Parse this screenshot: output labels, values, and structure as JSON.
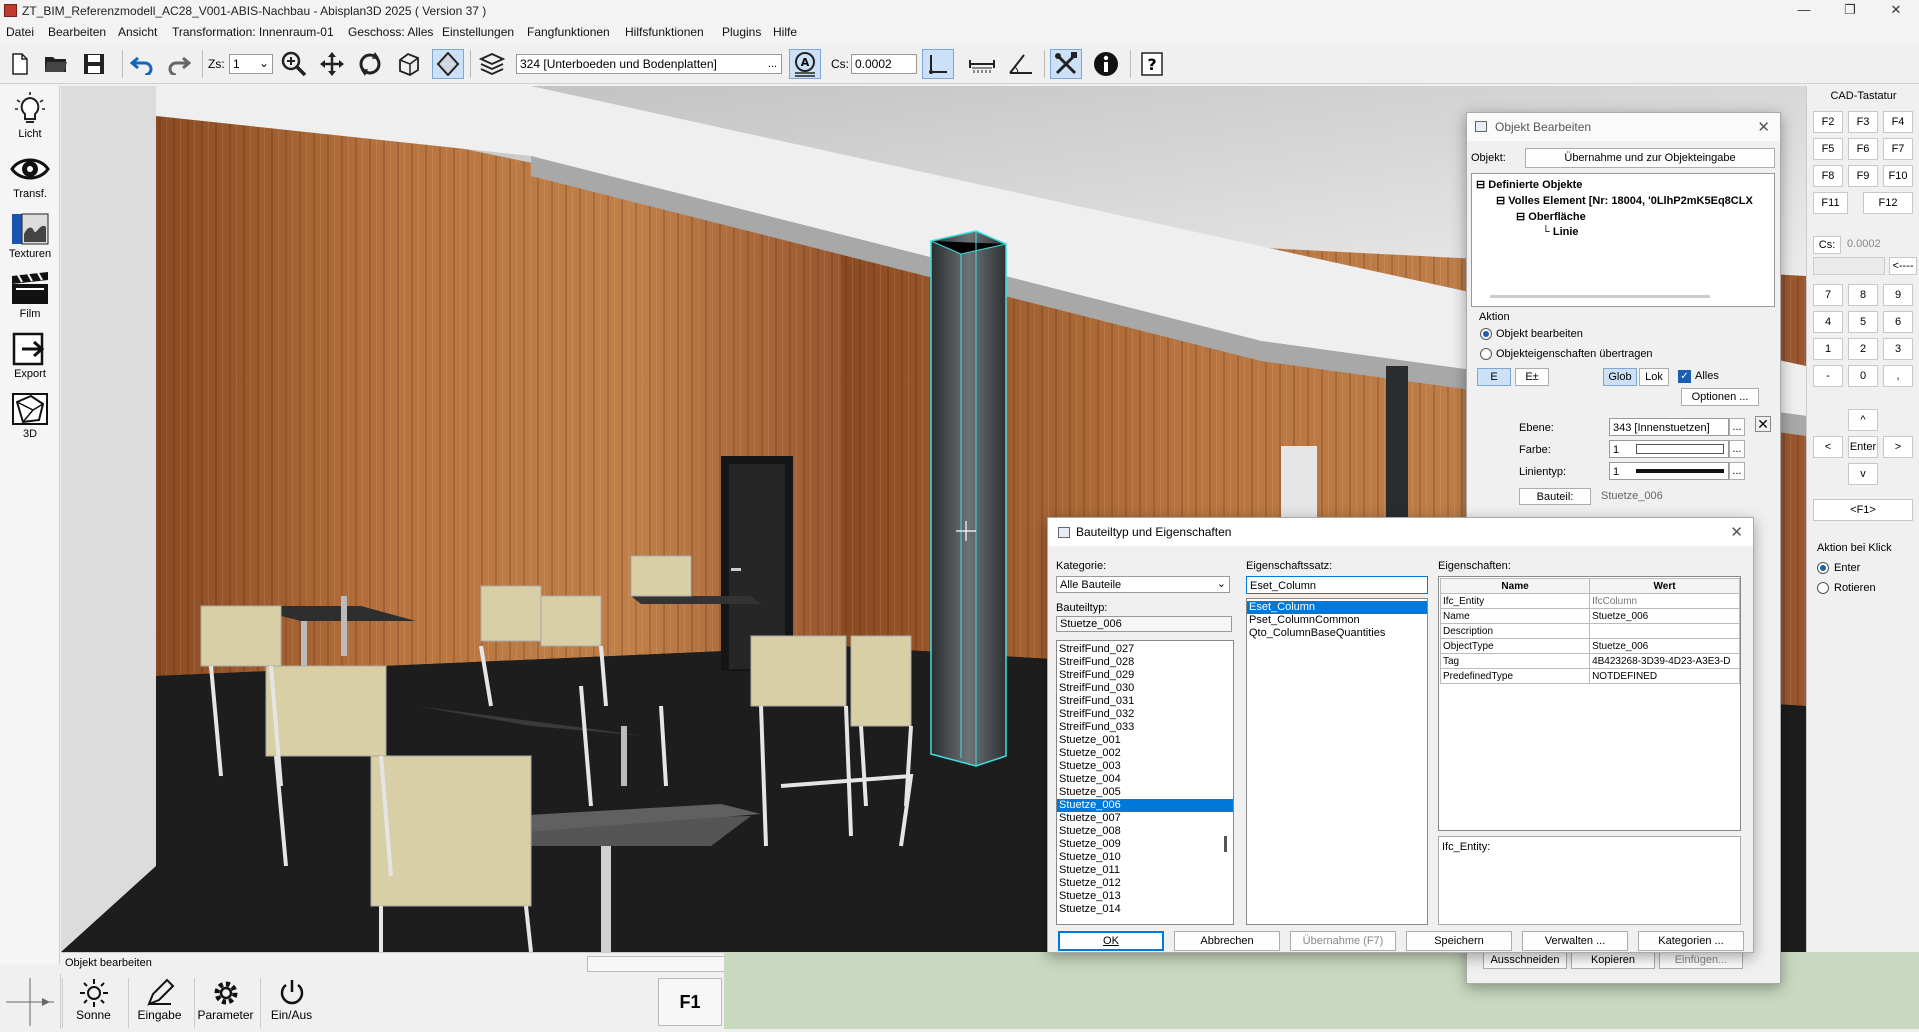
{
  "window": {
    "title": "ZT_BIM_Referenzmodell_AC28_V001-ABIS-Nachbau - Abisplan3D 2025 ( Version 37 )"
  },
  "menu": [
    "Datei",
    "Bearbeiten",
    "Ansicht",
    "Transformation: Innenraum-01",
    "Geschoss: Alles",
    "Einstellungen",
    "Fangfunktionen",
    "Hilfsfunktionen",
    "Plugins",
    "Hilfe"
  ],
  "toolbar": {
    "zs_label": "Zs:",
    "zs_value": "1",
    "layer_value": "324 [Unterboeden und Bodenplatten]",
    "layer_btn": "...",
    "cs_label": "Cs:",
    "cs_value": "0.0002"
  },
  "leftbar": [
    "Licht",
    "Transf.",
    "Texturen",
    "Film",
    "Export",
    "3D"
  ],
  "status": {
    "text": "Objekt bearbeiten"
  },
  "bottom": {
    "items": [
      "Sonne",
      "Eingabe",
      "Parameter",
      "Ein/Aus"
    ],
    "f1": "F1"
  },
  "cad": {
    "title": "CAD-Tastatur",
    "fkeys": [
      "F2",
      "F3",
      "F4",
      "F5",
      "F6",
      "F7",
      "F8",
      "F9",
      "F10",
      "F11",
      "F12"
    ],
    "cs_btn": "Cs:",
    "cs_value": "0.0002",
    "back": "<----",
    "num": [
      "7",
      "8",
      "9",
      "4",
      "5",
      "6",
      "1",
      "2",
      "3",
      "-",
      "0",
      ","
    ],
    "arrows": {
      "up": "^",
      "left": "<",
      "enter": "Enter",
      "right": ">",
      "down": "v"
    },
    "f1": "<F1>",
    "aktion_title": "Aktion bei Klick",
    "aktion_opts": [
      "Enter",
      "Rotieren"
    ]
  },
  "objekt": {
    "title": "Objekt Bearbeiten",
    "objekt_label": "Objekt:",
    "uebernahme_btn": "Übernahme und zur Objekteingabe",
    "tree": [
      "Definierte Objekte",
      "Volles Element [Nr: 18004, '0LlhP2mK5Eq8CLX",
      "Oberfläche",
      "Linie"
    ],
    "aktion_label": "Aktion",
    "opt1": "Objekt bearbeiten",
    "opt2": "Objekteigenschaften übertragen",
    "e_btn": "E",
    "epm_btn": "E±",
    "glob_btn": "Glob",
    "lok_btn": "Lok",
    "alles": "Alles",
    "optionen_btn": "Optionen ...",
    "ebene_label": "Ebene:",
    "ebene_value": "343 [Innenstuetzen]",
    "farbe_label": "Farbe:",
    "farbe_value": "1",
    "linientyp_label": "Linientyp:",
    "linientyp_value": "1",
    "bauteil_btn": "Bauteil:",
    "bauteil_value": "Stuetze_006",
    "dots": "...",
    "ausschneiden": "Ausschneiden",
    "kopieren": "Kopieren",
    "einfuegen": "Einfügen..."
  },
  "bauteil": {
    "title": "Bauteiltyp und Eigenschaften",
    "kategorie_label": "Kategorie:",
    "kategorie_value": "Alle Bauteile",
    "bauteiltyp_label": "Bauteiltyp:",
    "bauteiltyp_value": "Stuetze_006",
    "types": [
      "StreifFund_027",
      "StreifFund_028",
      "StreifFund_029",
      "StreifFund_030",
      "StreifFund_031",
      "StreifFund_032",
      "StreifFund_033",
      "Stuetze_001",
      "Stuetze_002",
      "Stuetze_003",
      "Stuetze_004",
      "Stuetze_005",
      "Stuetze_006",
      "Stuetze_007",
      "Stuetze_008",
      "Stuetze_009",
      "Stuetze_010",
      "Stuetze_011",
      "Stuetze_012",
      "Stuetze_013",
      "Stuetze_014"
    ],
    "selected_type": 12,
    "eigenschaftssatz_label": "Eigenschaftssatz:",
    "eigenschaftssatz_value": "Eset_Column",
    "sets": [
      "Eset_Column",
      "Pset_ColumnCommon",
      "Qto_ColumnBaseQuantities"
    ],
    "eigenschaften_label": "Eigenschaften:",
    "col_name": "Name",
    "col_wert": "Wert",
    "props": [
      [
        "Ifc_Entity",
        "IfcColumn"
      ],
      [
        "Name",
        "Stuetze_006"
      ],
      [
        "Description",
        ""
      ],
      [
        "ObjectType",
        "Stuetze_006"
      ],
      [
        "Tag",
        "4B423268-3D39-4D23-A3E3-D"
      ],
      [
        "PredefinedType",
        "NOTDEFINED"
      ]
    ],
    "detail": "Ifc_Entity:",
    "ok": "OK",
    "abbrechen": "Abbrechen",
    "uebernahme": "Übernahme (F7)",
    "speichern": "Speichern",
    "verwalten": "Verwalten ...",
    "kategorien": "Kategorien ..."
  },
  "colors": {
    "accent": "#0078d7",
    "wood": "#b06a3c",
    "floor": "#1e1e1e",
    "ceiling": "#e8e8e8"
  }
}
